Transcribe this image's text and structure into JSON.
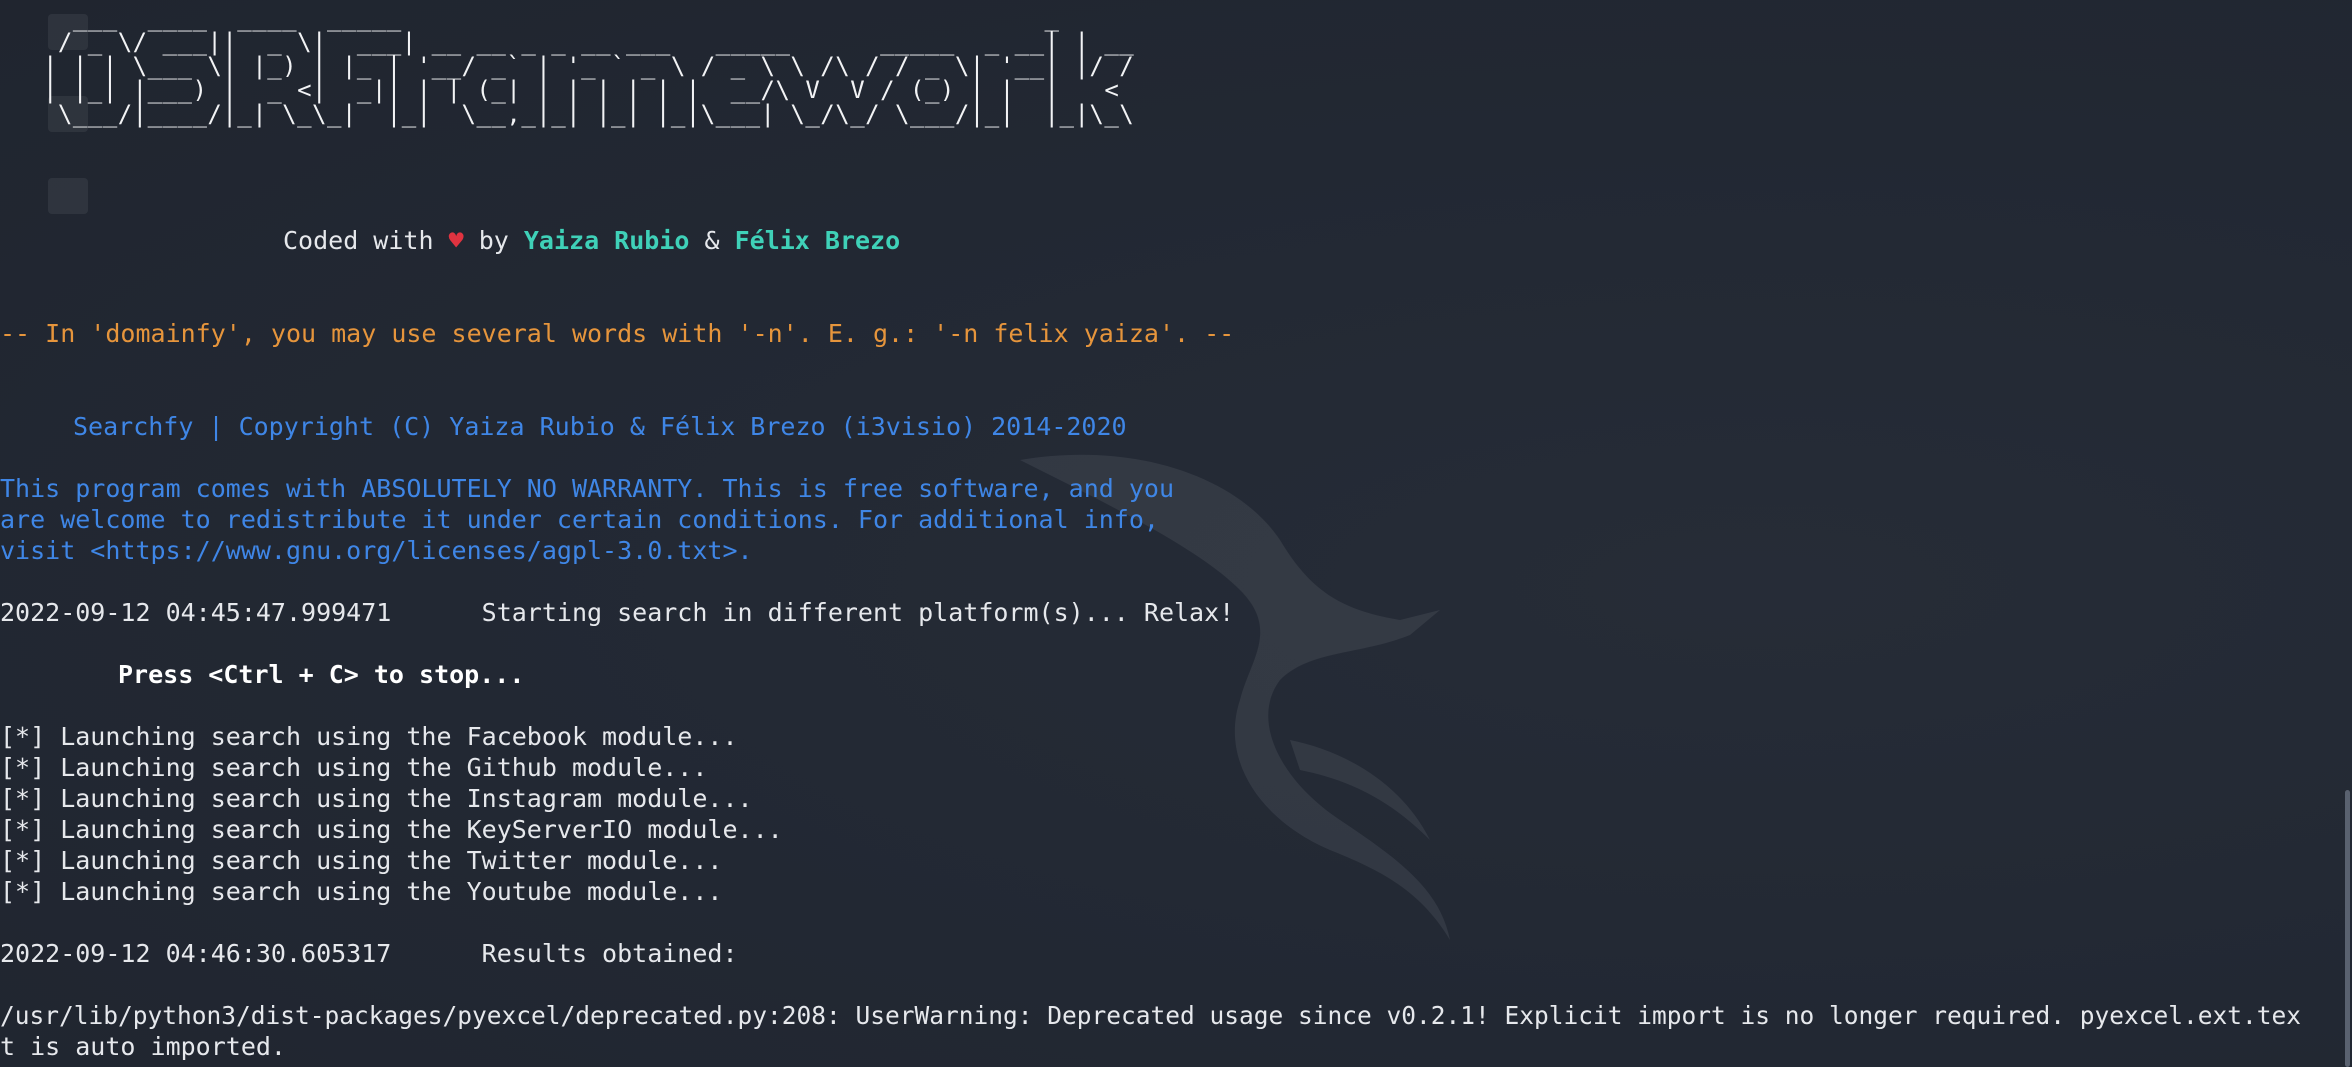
{
  "banner": {
    "ascii_art": "   ___  ____  ____  _____                                           _    \n  / _ \\/ ___||  _ \\|  ___| __ __ _ _ __ ___   _____      _____  _ __| | __\n | | | \\___ \\| |_) | |_ | '__/ _` | '_ ` _ \\ / _ \\ \\ /\\ / / _ \\| '__| |/ /\n | |_| |___) |  _ <|  _|| | | (_| | | | | | |  __/\\ V  V / (_) | |  |   < \n  \\___/|____/|_| \\_\\_|  |_|  \\__,_|_| |_| |_|\\___| \\_/\\_/ \\___/|_|  |_|\\_\\",
    "credit_prefix": "Coded with ",
    "heart": "♥",
    "credit_by": " by ",
    "author1": "Yaiza Rubio",
    "amp": " & ",
    "author2": "Félix Brezo"
  },
  "tip": "-- In 'domainfy', you may use several words with '-n'. E. g.: '-n felix yaiza'. --",
  "copyright": "Searchfy | Copyright (C) Yaiza Rubio & Félix Brezo (i3visio) 2014-2020",
  "license_lines": [
    "This program comes with ABSOLUTELY NO WARRANTY. This is free software, and you",
    "are welcome to redistribute it under certain conditions. For additional info,",
    "visit <https://www.gnu.org/licenses/agpl-3.0.txt>."
  ],
  "start_line": "2022-09-12 04:45:47.999471      Starting search in different platform(s)... Relax!",
  "press_stop": "Press <Ctrl + C> to stop...",
  "modules": [
    "[*] Launching search using the Facebook module...",
    "[*] Launching search using the Github module...",
    "[*] Launching search using the Instagram module...",
    "[*] Launching search using the KeyServerIO module...",
    "[*] Launching search using the Twitter module...",
    "[*] Launching search using the Youtube module..."
  ],
  "results_line": "2022-09-12 04:46:30.605317      Results obtained:",
  "warning_lines": [
    "/usr/lib/python3/dist-packages/pyexcel/deprecated.py:208: UserWarning: Deprecated usage since v0.2.1! Explicit import is no longer required. pyexcel.ext.tex",
    "t is auto imported."
  ],
  "colors": {
    "background": "#222833",
    "foreground": "#e6e8ec",
    "accent_cyan": "#3fd1b8",
    "heart_red": "#e03340",
    "tip_orange": "#e6953c",
    "info_blue": "#3f86e6"
  },
  "icons": {
    "watermark": "kali-dragon-icon"
  }
}
